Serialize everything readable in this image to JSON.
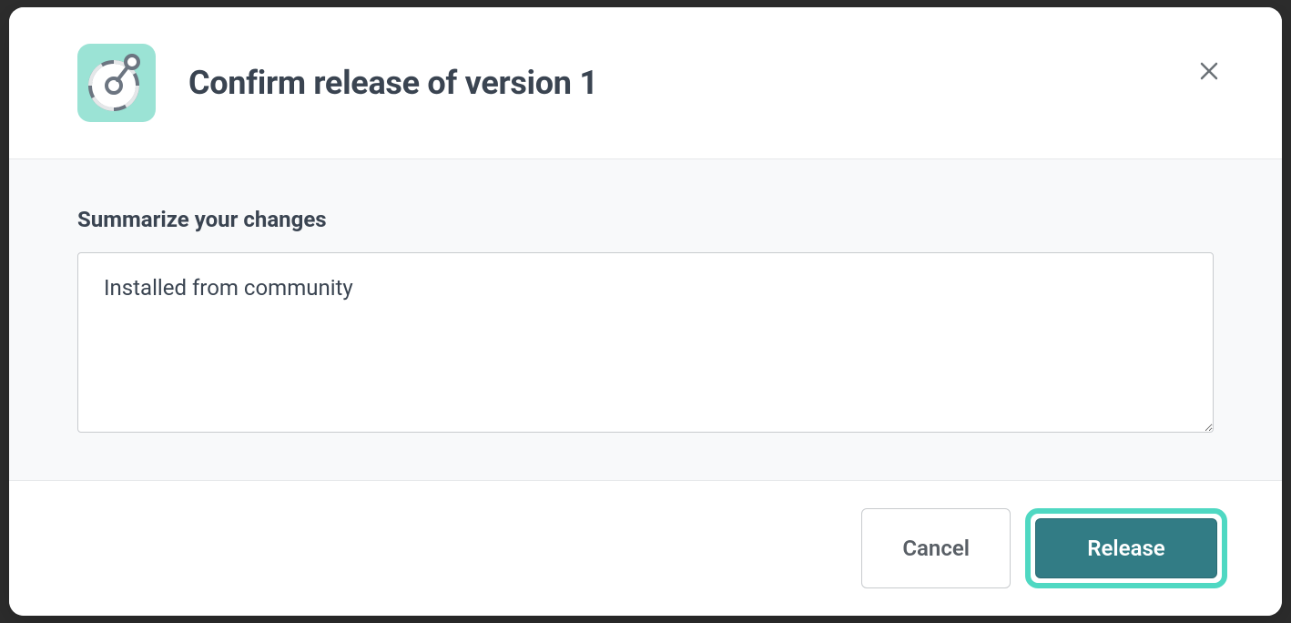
{
  "modal": {
    "title": "Confirm release of version 1",
    "summaryLabel": "Summarize your changes",
    "summaryValue": "Installed from community",
    "cancelLabel": "Cancel",
    "releaseLabel": "Release"
  },
  "icons": {
    "release": "release-icon",
    "close": "close-icon"
  },
  "colors": {
    "accent": "#4fd8c2",
    "primaryButton": "#327c85",
    "iconBg": "#9be3d5"
  }
}
